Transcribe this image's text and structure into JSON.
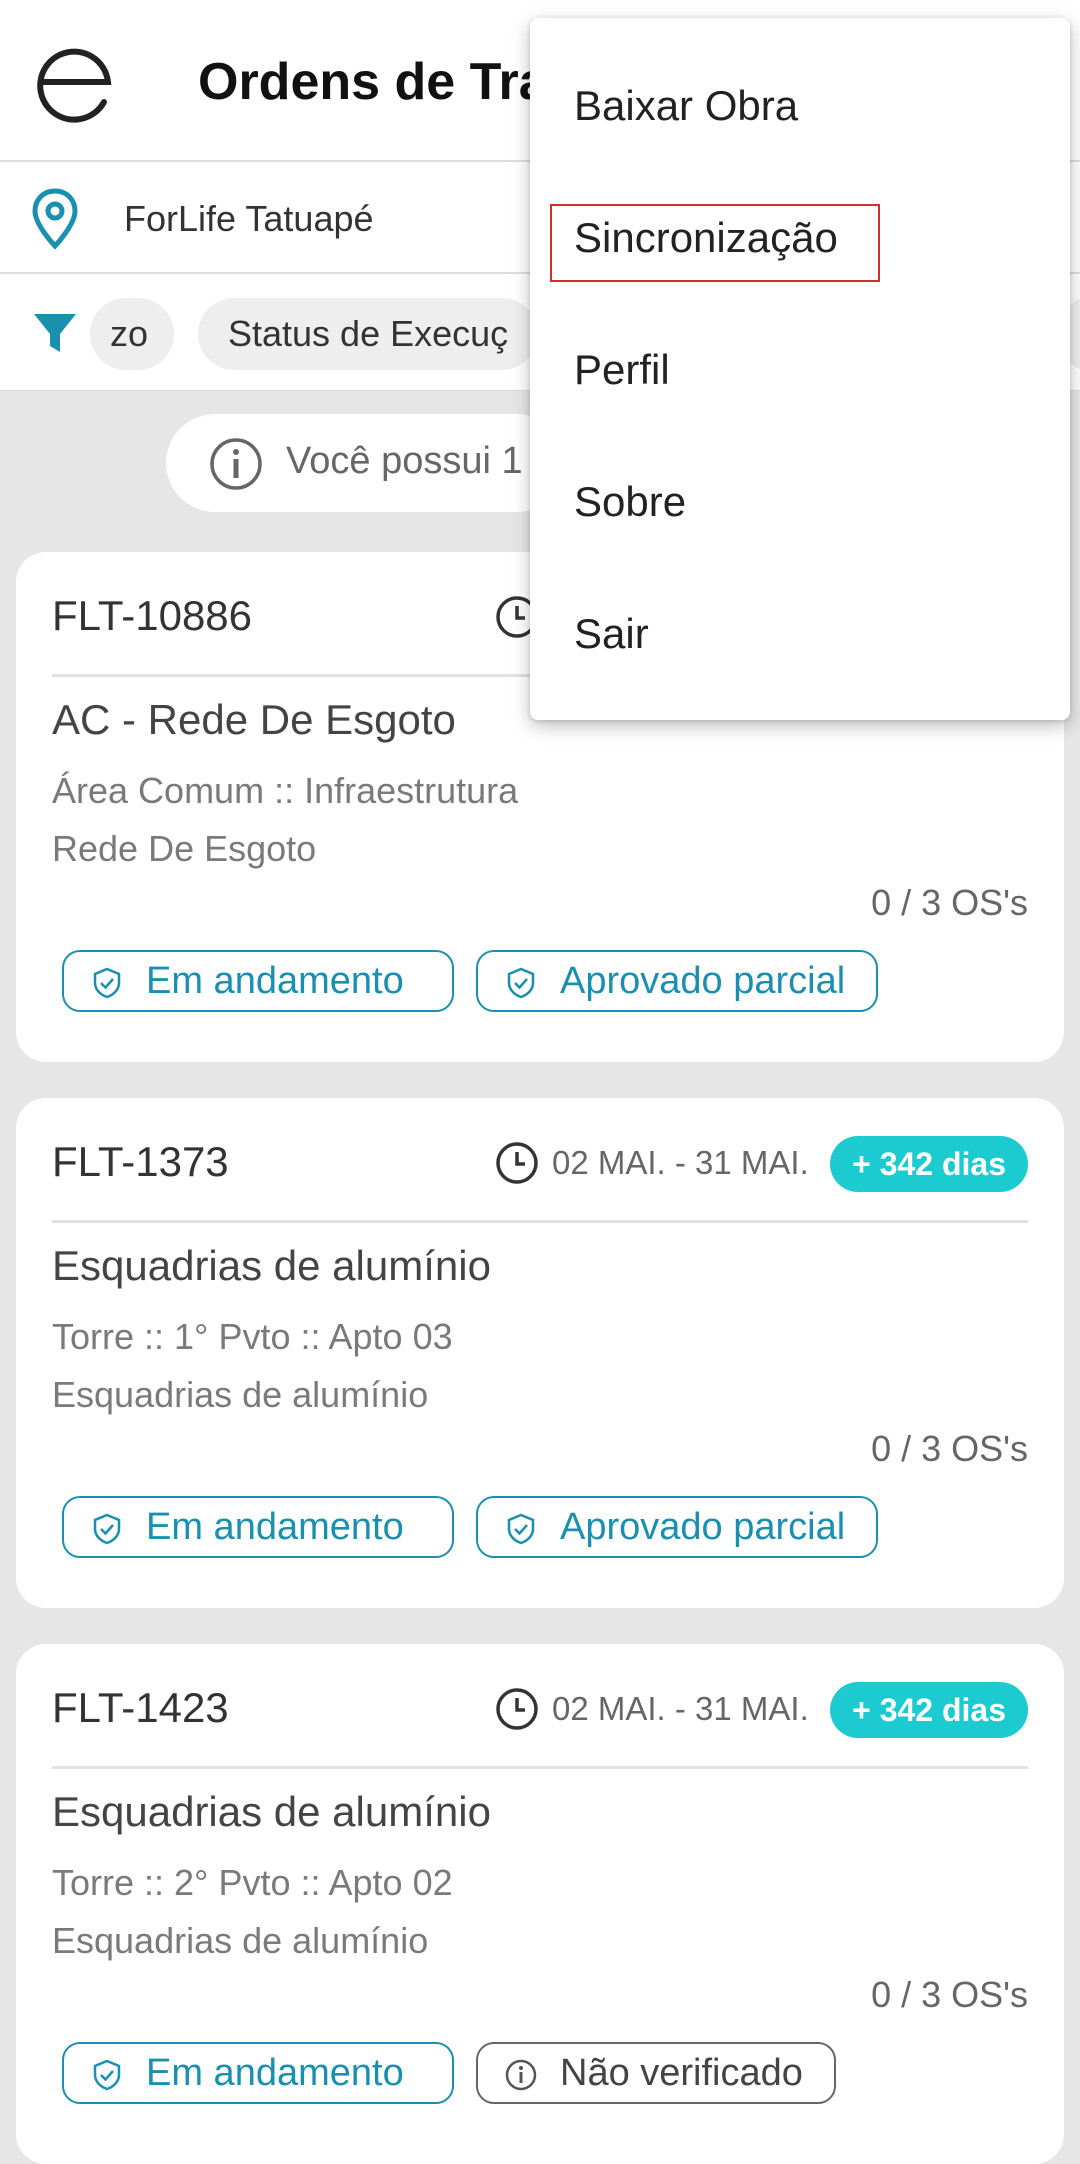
{
  "header": {
    "title": "Ordens de Tra"
  },
  "location": {
    "name": "ForLife Tatuapé"
  },
  "filters": {
    "chips": [
      "zo",
      "Status de Execuç"
    ]
  },
  "info_banner": {
    "text": "Você possui 1"
  },
  "cards": [
    {
      "code": "FLT-10886",
      "date": "",
      "badge": "",
      "name": "AC - Rede De Esgoto",
      "location": "Área Comum :: Infraestrutura",
      "subtitle": "Rede De Esgoto",
      "count": "0 / 3 OS's",
      "tags": [
        {
          "label": "Em andamento",
          "icon": "shield-check-icon"
        },
        {
          "label": "Aprovado parcial",
          "icon": "shield-check-icon"
        }
      ]
    },
    {
      "code": "FLT-1373",
      "date": "02 MAI. - 31 MAI.",
      "badge": "+ 342 dias",
      "name": "Esquadrias de alumínio",
      "location": "Torre :: 1° Pvto :: Apto 03",
      "subtitle": "Esquadrias de alumínio",
      "count": "0 / 3 OS's",
      "tags": [
        {
          "label": "Em andamento",
          "icon": "shield-check-icon"
        },
        {
          "label": "Aprovado parcial",
          "icon": "shield-check-icon"
        }
      ]
    },
    {
      "code": "FLT-1423",
      "date": "02 MAI. - 31 MAI.",
      "badge": "+ 342 dias",
      "name": "Esquadrias de alumínio",
      "location": "Torre :: 2° Pvto :: Apto 02",
      "subtitle": "Esquadrias de alumínio",
      "count": "0 / 3 OS's",
      "tags": [
        {
          "label": "Em andamento",
          "icon": "shield-check-icon"
        },
        {
          "label": "Não verificado",
          "icon": "info-icon"
        }
      ]
    }
  ],
  "menu": {
    "items": [
      "Baixar Obra",
      "Sincronização",
      "Perfil",
      "Sobre",
      "Sair"
    ],
    "highlighted": "Sincronização"
  },
  "colors": {
    "accent": "#1a8fb0",
    "badge": "#1ccbd0",
    "highlight_border": "#d32f2f"
  }
}
